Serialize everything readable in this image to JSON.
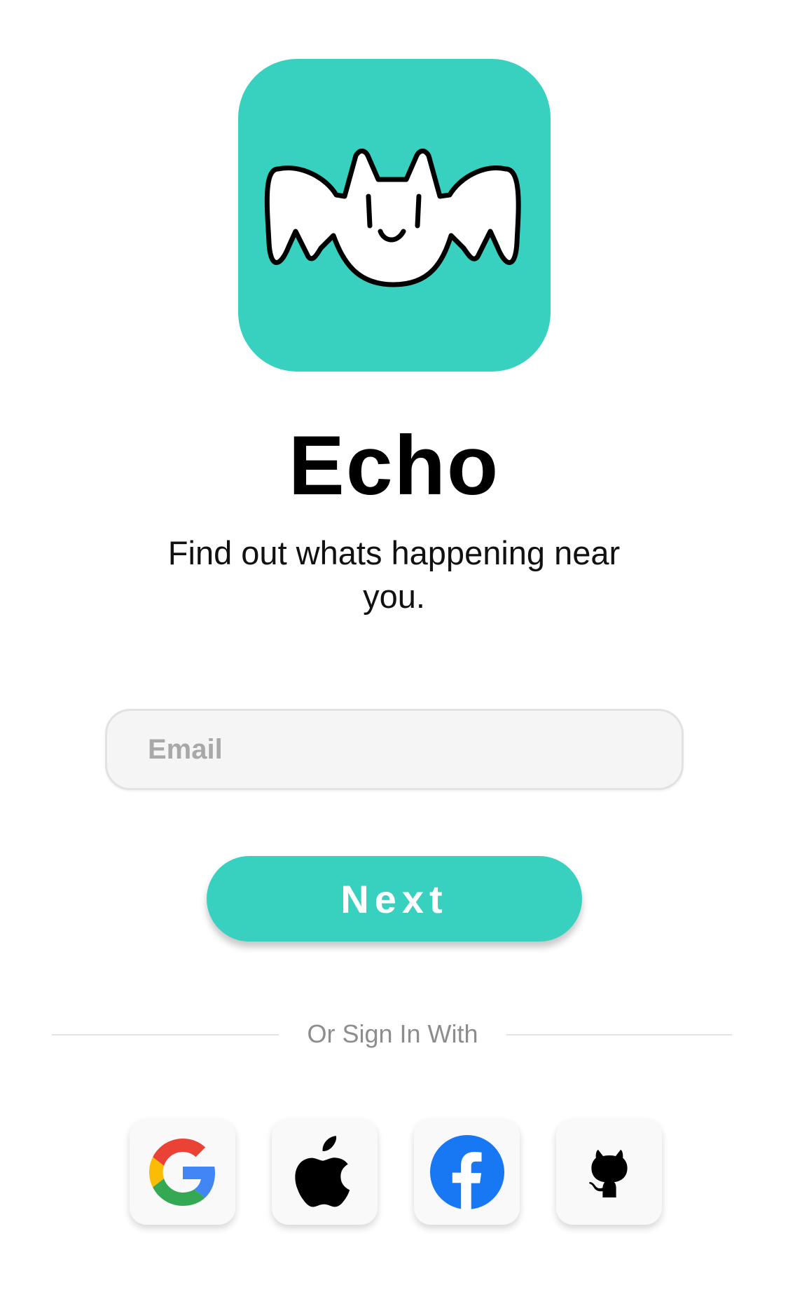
{
  "app": {
    "title": "Echo",
    "tagline": "Find out whats happening near you.",
    "logo_icon": "bat-logo-icon"
  },
  "form": {
    "email_placeholder": "Email",
    "email_value": "",
    "next_label": "Next"
  },
  "divider": {
    "text": "Or Sign In With"
  },
  "social": [
    {
      "name": "google",
      "icon": "google-icon"
    },
    {
      "name": "apple",
      "icon": "apple-icon"
    },
    {
      "name": "facebook",
      "icon": "facebook-icon"
    },
    {
      "name": "github",
      "icon": "github-icon"
    }
  ],
  "colors": {
    "accent": "#38d1bf",
    "background": "#ffffff",
    "field_background": "#f5f5f5",
    "muted_text": "#8d8d8d",
    "facebook_blue": "#1877f2"
  }
}
